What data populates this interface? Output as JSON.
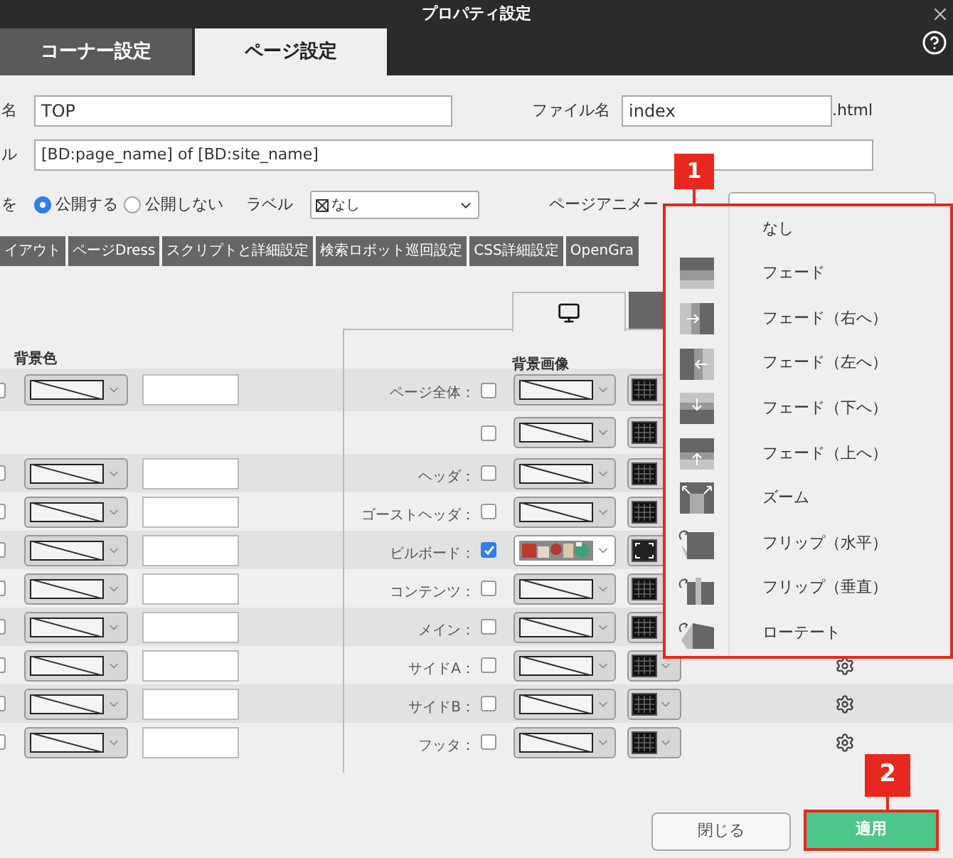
{
  "window": {
    "title": "プロパティ設定"
  },
  "tabs": [
    {
      "label": "コーナー設定",
      "selected": false
    },
    {
      "label": "ページ設定",
      "selected": true
    }
  ],
  "form": {
    "page_name_label": "名",
    "page_name": "TOP",
    "file_name_label": "ファイル名",
    "file_name": "index",
    "file_ext": ".html",
    "title_label": "ル",
    "title": "[BD:page_name] of [BD:site_name]",
    "publish_label": "を",
    "publish_options": [
      {
        "label": "公開する",
        "selected": true
      },
      {
        "label": "公開しない",
        "selected": false
      }
    ],
    "label_label": "ラベル",
    "label_value": "なし",
    "animation_label": "ページアニメー"
  },
  "subtabs": [
    "イアウト",
    "ページDress",
    "スクリプトと詳細設定",
    "検索ロボット巡回設定",
    "CSS詳細設定",
    "OpenGra"
  ],
  "bg_color_header": "背景色",
  "bg_image_header": "背景画像",
  "rows": [
    {
      "label": "ページ全体：",
      "color_controls": true,
      "color_checked": false,
      "image_checked": false,
      "kind": "pattern"
    },
    {
      "color_controls": false,
      "image_checked": false,
      "kind": "pattern"
    },
    {
      "label": "ヘッダ：",
      "color_controls": true,
      "color_checked": false,
      "image_checked": false,
      "kind": "pattern"
    },
    {
      "label": "ゴーストヘッダ：",
      "color_controls": true,
      "color_checked": false,
      "image_checked": false,
      "kind": "pattern"
    },
    {
      "label": "ビルボード：",
      "color_controls": true,
      "color_checked": false,
      "image_checked": true
    },
    {
      "label": "コンテンツ：",
      "color_controls": true,
      "color_checked": false,
      "image_checked": false,
      "kind": "pattern"
    },
    {
      "label": "メイン：",
      "color_controls": true,
      "color_checked": false,
      "image_checked": false,
      "kind": "pattern"
    },
    {
      "label": "サイドA：",
      "color_controls": true,
      "color_checked": false,
      "image_checked": false,
      "kind": "pattern"
    },
    {
      "label": "サイドB：",
      "color_controls": true,
      "color_checked": false,
      "image_checked": false,
      "kind": "pattern"
    },
    {
      "label": "フッタ：",
      "color_controls": true,
      "color_checked": false,
      "image_checked": false,
      "kind": "pattern"
    }
  ],
  "animation_menu": [
    {
      "label": "なし",
      "kind": "none"
    },
    {
      "label": "フェード",
      "kind": "fade"
    },
    {
      "label": "フェード（右へ）",
      "kind": "fade_right"
    },
    {
      "label": "フェード（左へ）",
      "kind": "fade_left"
    },
    {
      "label": "フェード（下へ）",
      "kind": "fade_down"
    },
    {
      "label": "フェード（上へ）",
      "kind": "fade_up"
    },
    {
      "label": "ズーム",
      "kind": "zoom"
    },
    {
      "label": "フリップ（水平）",
      "kind": "flip_h"
    },
    {
      "label": "フリップ（垂直）",
      "kind": "flip_v"
    },
    {
      "label": "ローテート",
      "kind": "rotate"
    }
  ],
  "callouts": [
    "1",
    "2"
  ],
  "buttons": {
    "close": "閉じる",
    "apply": "適用"
  }
}
